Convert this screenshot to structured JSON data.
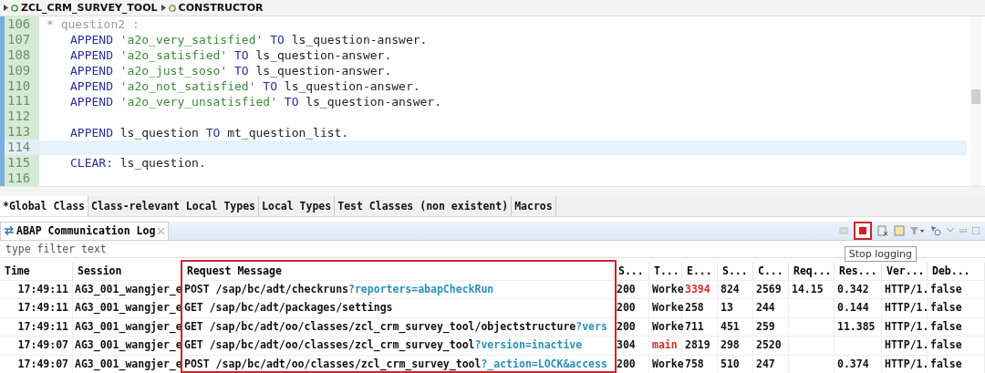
{
  "breadcrumb": [
    {
      "label": "ZCL_CRM_SURVEY_TOOL",
      "kind": "class"
    },
    {
      "label": "CONSTRUCTOR",
      "kind": "method"
    }
  ],
  "editor": {
    "lines": [
      {
        "number": "106",
        "current": false,
        "indent": false,
        "tokens": [
          {
            "kind": "comment",
            "text": "* question2 :"
          }
        ]
      },
      {
        "number": "107",
        "current": false,
        "indent": true,
        "tokens": [
          {
            "kind": "keyword",
            "text": "APPEND"
          },
          {
            "kind": "string",
            "text": "'a2o_very_satisfied'"
          },
          {
            "kind": "keyword",
            "text": "TO"
          },
          {
            "kind": "plain",
            "text": "ls_question-answer."
          }
        ]
      },
      {
        "number": "108",
        "current": false,
        "indent": true,
        "tokens": [
          {
            "kind": "keyword",
            "text": "APPEND"
          },
          {
            "kind": "string",
            "text": "'a2o_satisfied'"
          },
          {
            "kind": "keyword",
            "text": "TO"
          },
          {
            "kind": "plain",
            "text": "ls_question-answer."
          }
        ]
      },
      {
        "number": "109",
        "current": false,
        "indent": true,
        "tokens": [
          {
            "kind": "keyword",
            "text": "APPEND"
          },
          {
            "kind": "string",
            "text": "'a2o_just_soso'"
          },
          {
            "kind": "keyword",
            "text": "TO"
          },
          {
            "kind": "plain",
            "text": "ls_question-answer."
          }
        ]
      },
      {
        "number": "110",
        "current": false,
        "indent": true,
        "tokens": [
          {
            "kind": "keyword",
            "text": "APPEND"
          },
          {
            "kind": "string",
            "text": "'a2o_not_satisfied'"
          },
          {
            "kind": "keyword",
            "text": "TO"
          },
          {
            "kind": "plain",
            "text": "ls_question-answer."
          }
        ]
      },
      {
        "number": "111",
        "current": false,
        "indent": true,
        "tokens": [
          {
            "kind": "keyword",
            "text": "APPEND"
          },
          {
            "kind": "string",
            "text": "'a2o_very_unsatisfied'"
          },
          {
            "kind": "keyword",
            "text": "TO"
          },
          {
            "kind": "plain",
            "text": "ls_question-answer."
          }
        ]
      },
      {
        "number": "112",
        "current": false,
        "indent": false
      },
      {
        "number": "113",
        "current": false,
        "indent": true,
        "tokens": [
          {
            "kind": "keyword",
            "text": "APPEND"
          },
          {
            "kind": "plain",
            "text": "ls_question"
          },
          {
            "kind": "keyword",
            "text": "TO"
          },
          {
            "kind": "plain",
            "text": "mt_question_list."
          }
        ]
      },
      {
        "number": "114",
        "current": true,
        "indent": false
      },
      {
        "number": "115",
        "current": false,
        "indent": true,
        "tokens": [
          {
            "kind": "keyword",
            "text": "CLEAR:"
          },
          {
            "kind": "plain",
            "text": "ls_question."
          }
        ]
      },
      {
        "number": "116",
        "current": false,
        "indent": false
      }
    ]
  },
  "editor_tabs": [
    {
      "label": "*Global Class",
      "selected": true
    },
    {
      "label": "Class-relevant Local Types",
      "selected": false
    },
    {
      "label": "Local Types",
      "selected": false
    },
    {
      "label": "Test Classes (non existent)",
      "selected": false
    },
    {
      "label": "Macros",
      "selected": false
    }
  ],
  "view": {
    "title": "ABAP Communication Log",
    "filter": {
      "placeholder": "type filter text"
    },
    "tooltip": "Stop logging"
  },
  "table": {
    "columns": [
      "Time",
      "Session",
      "Request Message",
      "S...",
      "T...",
      "E...",
      "S...",
      "C...",
      "Req...",
      "Res...",
      "Ver...",
      "Deb..."
    ],
    "rows": [
      {
        "cells": [
          {
            "text": "17:49:11",
            "alert": false
          },
          {
            "text": "AG3_001_wangjer_e",
            "alert": false
          },
          {
            "text": "POST /sap/bc/adt/checkruns",
            "query": "?reporters=abapCheckRun",
            "alert": false
          },
          {
            "text": "200",
            "alert": false
          },
          {
            "text": "Worke",
            "alert": false
          },
          {
            "text": "3394",
            "alert": true
          },
          {
            "text": "824",
            "alert": false
          },
          {
            "text": "2569",
            "alert": false
          },
          {
            "text": "14.15",
            "alert": false
          },
          {
            "text": "0.342",
            "alert": false
          },
          {
            "text": "HTTP/1.",
            "alert": false
          },
          {
            "text": "false",
            "alert": false
          }
        ]
      },
      {
        "cells": [
          {
            "text": "17:49:11",
            "alert": false
          },
          {
            "text": "AG3_001_wangjer_e",
            "alert": false
          },
          {
            "text": "GET /sap/bc/adt/packages/settings",
            "alert": false
          },
          {
            "text": "200",
            "alert": false
          },
          {
            "text": "Worke",
            "alert": false
          },
          {
            "text": "258",
            "alert": false
          },
          {
            "text": "13",
            "alert": false
          },
          {
            "text": "244",
            "alert": false
          },
          null,
          {
            "text": "0.144",
            "alert": false
          },
          {
            "text": "HTTP/1.",
            "alert": false
          },
          {
            "text": "false",
            "alert": false
          }
        ]
      },
      {
        "cells": [
          {
            "text": "17:49:11",
            "alert": false
          },
          {
            "text": "AG3_001_wangjer_e",
            "alert": false
          },
          {
            "text": "GET /sap/bc/adt/oo/classes/zcl_crm_survey_tool/objectstructure",
            "query": "?vers",
            "alert": false
          },
          {
            "text": "200",
            "alert": false
          },
          {
            "text": "Worke",
            "alert": false
          },
          {
            "text": "711",
            "alert": false
          },
          {
            "text": "451",
            "alert": false
          },
          {
            "text": "259",
            "alert": false
          },
          null,
          {
            "text": "11.385",
            "alert": false
          },
          {
            "text": "HTTP/1.",
            "alert": false
          },
          {
            "text": "false",
            "alert": false
          }
        ]
      },
      {
        "cells": [
          {
            "text": "17:49:07",
            "alert": false
          },
          {
            "text": "AG3_001_wangjer_e",
            "alert": false
          },
          {
            "text": "GET /sap/bc/adt/oo/classes/zcl_crm_survey_tool",
            "query": "?version=inactive",
            "alert": false
          },
          {
            "text": "304",
            "alert": false
          },
          {
            "text": "main",
            "alert": true
          },
          {
            "text": "2819",
            "alert": false
          },
          {
            "text": "298",
            "alert": false
          },
          {
            "text": "2520",
            "alert": false
          },
          null,
          null,
          {
            "text": "HTTP/1.",
            "alert": false
          },
          {
            "text": "false",
            "alert": false
          }
        ]
      },
      {
        "cells": [
          {
            "text": "17:49:07",
            "alert": false
          },
          {
            "text": "AG3_001_wangjer_e",
            "alert": false
          },
          {
            "text": "POST /sap/bc/adt/oo/classes/zcl_crm_survey_tool",
            "query": "?_action=LOCK&access",
            "alert": false
          },
          {
            "text": "200",
            "alert": false
          },
          {
            "text": "Worke",
            "alert": false
          },
          {
            "text": "758",
            "alert": false
          },
          {
            "text": "510",
            "alert": false
          },
          {
            "text": "247",
            "alert": false
          },
          null,
          {
            "text": "0.374",
            "alert": false
          },
          {
            "text": "HTTP/1.",
            "alert": false
          },
          {
            "text": "false",
            "alert": false
          }
        ]
      }
    ]
  }
}
